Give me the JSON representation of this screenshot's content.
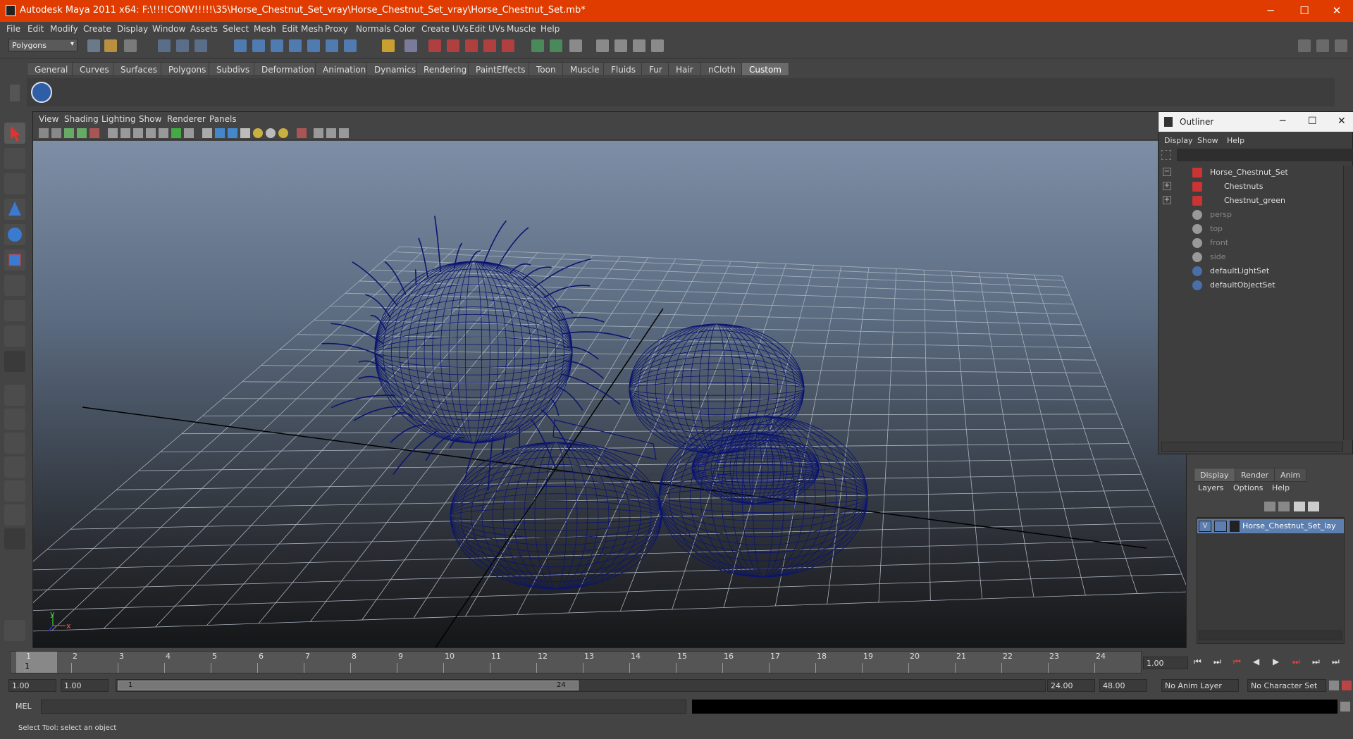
{
  "window": {
    "title": "Autodesk Maya 2011 x64: F:\\!!!!CONV!!!!!\\35\\Horse_Chestnut_Set_vray\\Horse_Chestnut_Set_vray\\Horse_Chestnut_Set.mb*",
    "minimize": "─",
    "maximize": "☐",
    "close": "✕"
  },
  "menubar": [
    "File",
    "Edit",
    "Modify",
    "Create",
    "Display",
    "Window",
    "Assets",
    "Select",
    "Mesh",
    "Edit Mesh",
    "Proxy",
    "Normals",
    "Color",
    "Create UVs",
    "Edit UVs",
    "Muscle",
    "Help"
  ],
  "status_line": {
    "mode": "Polygons"
  },
  "shelf_tabs": [
    "General",
    "Curves",
    "Surfaces",
    "Polygons",
    "Subdivs",
    "Deformation",
    "Animation",
    "Dynamics",
    "Rendering",
    "PaintEffects",
    "Toon",
    "Muscle",
    "Fluids",
    "Fur",
    "Hair",
    "nCloth",
    "Custom"
  ],
  "active_shelf": "Custom",
  "viewport": {
    "menu": [
      "View",
      "Shading",
      "Lighting",
      "Show",
      "Renderer",
      "Panels"
    ],
    "axis_y": "y",
    "axis_x": "x"
  },
  "outliner": {
    "title": "Outliner",
    "menu": [
      "Display",
      "Show",
      "Help"
    ],
    "items": [
      {
        "label": "Horse_Chestnut_Set",
        "expand": "−",
        "icon": "transform-icon",
        "dim": false
      },
      {
        "label": "Chestnuts",
        "expand": "+",
        "icon": "transform-icon",
        "dim": false
      },
      {
        "label": "Chestnut_green",
        "expand": "+",
        "icon": "transform-icon",
        "dim": false
      },
      {
        "label": "persp",
        "expand": "",
        "icon": "camera-icon",
        "dim": true
      },
      {
        "label": "top",
        "expand": "",
        "icon": "camera-icon",
        "dim": true
      },
      {
        "label": "front",
        "expand": "",
        "icon": "camera-icon",
        "dim": true
      },
      {
        "label": "side",
        "expand": "",
        "icon": "camera-icon",
        "dim": true
      },
      {
        "label": "defaultLightSet",
        "expand": "",
        "icon": "set-icon",
        "dim": false
      },
      {
        "label": "defaultObjectSet",
        "expand": "",
        "icon": "set-icon",
        "dim": false
      }
    ]
  },
  "layer_editor": {
    "tabs": [
      "Display",
      "Render",
      "Anim"
    ],
    "menu": [
      "Layers",
      "Options",
      "Help"
    ],
    "layer": {
      "visible": "V",
      "name": "Horse_Chestnut_Set_lay"
    }
  },
  "time_slider": {
    "ticks": [
      "1",
      "2",
      "3",
      "4",
      "5",
      "6",
      "7",
      "8",
      "9",
      "10",
      "11",
      "12",
      "13",
      "14",
      "15",
      "16",
      "17",
      "18",
      "19",
      "20",
      "21",
      "22",
      "23",
      "24"
    ],
    "current_frame": "1",
    "current_time_field": "1.00"
  },
  "range_slider": {
    "start_field": "1.00",
    "playback_start": "1.00",
    "range_start_label": "1",
    "range_end_label": "24",
    "playback_end": "24.00",
    "end_field": "48.00",
    "anim_layer": "No Anim Layer",
    "character_set": "No Character Set"
  },
  "command_line": {
    "label": "MEL",
    "value": ""
  },
  "help_line": {
    "text": "Select Tool: select an object"
  },
  "colors": {
    "titlebar": "#e03c00",
    "wireframe": "#0b1570",
    "ui": "#444444"
  }
}
